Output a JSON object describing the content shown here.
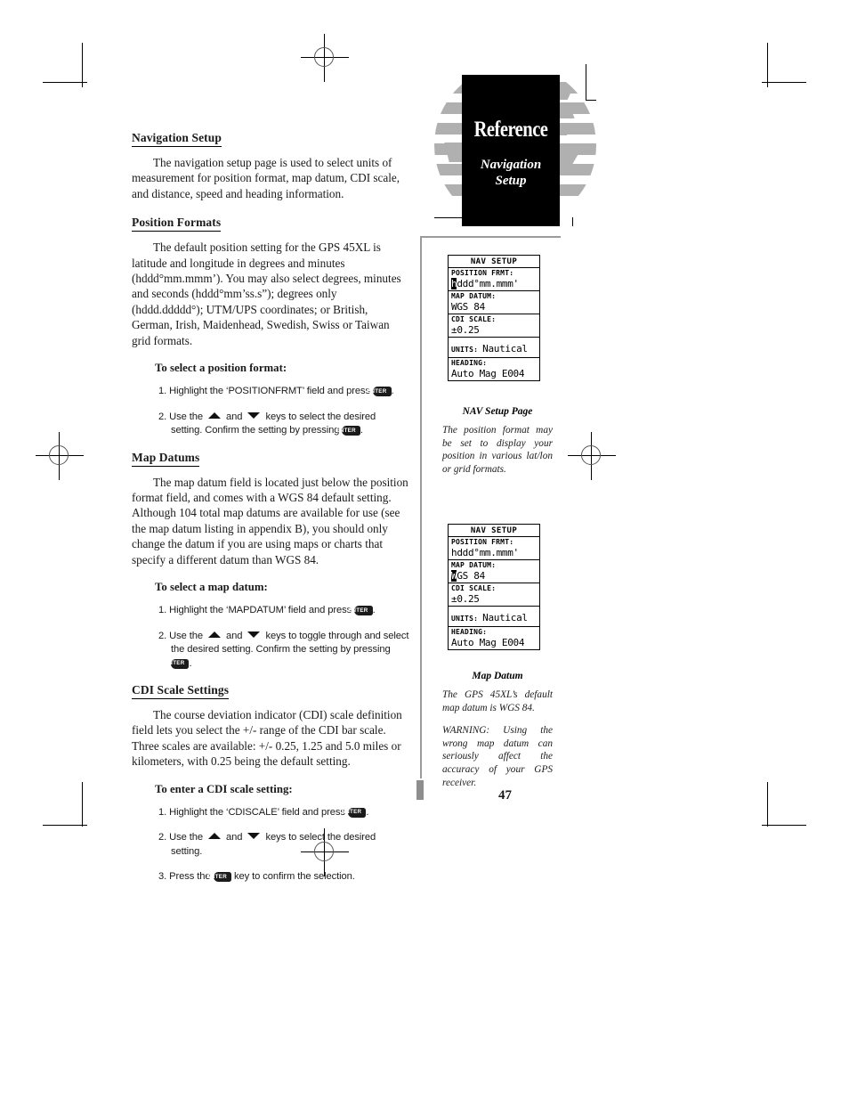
{
  "header": {
    "reference_label": "Reference",
    "section_line1": "Navigation",
    "section_line2": "Setup"
  },
  "page_number": "47",
  "left_column": {
    "sections": [
      {
        "heading": "Navigation Setup",
        "paragraphs": [
          "The navigation setup page is used to select units of measurement for position format, map datum, CDI scale, and distance, speed and heading information."
        ]
      },
      {
        "heading": "Position Formats",
        "paragraphs": [
          "The default position setting for the GPS 45XL is latitude and longitude in degrees and minutes (hddd°mm.mmm’). You may also select degrees, minutes and seconds (hddd°mm’ss.s”); degrees only (hddd.ddddd°); UTM/UPS coordinates; or British, German, Irish, Maidenhead, Swedish, Swiss or Taiwan grid formats."
        ],
        "procedure_title": "To select a position format:",
        "steps": [
          {
            "num": "1.",
            "before": "Highlight the ‘POSITIONFRMT’ field and press",
            "key1": "ENTER",
            "after": "."
          },
          {
            "num": "2.",
            "before": "Use the",
            "arrows": true,
            "mid": "and",
            "after_arrows": "keys to select the desired setting. Confirm the setting by pressing",
            "key1": "ENTER",
            "after": "."
          }
        ]
      },
      {
        "heading": "Map Datums",
        "paragraphs": [
          "The map datum field is located just below the position format field, and comes with a WGS 84 default setting. Although 104 total map datums are available for use (see the map datum listing in appendix B), you should only change the datum if you are using maps or charts that specify a different datum than WGS 84."
        ],
        "procedure_title": "To select a map datum:",
        "steps": [
          {
            "num": "1.",
            "before": "Highlight the ‘MAPDATUM’ field and press",
            "key1": "ENTER",
            "after": "."
          },
          {
            "num": "2.",
            "before": "Use the",
            "arrows": true,
            "mid": "and",
            "after_arrows": "keys to toggle through and select the desired setting. Confirm the setting by pressing",
            "key1": "ENTER",
            "after": "."
          }
        ]
      },
      {
        "heading": "CDI Scale Settings",
        "paragraphs": [
          "The course deviation indicator (CDI) scale definition field lets you select the +/- range of the CDI bar scale. Three scales are available: +/- 0.25, 1.25 and 5.0 miles or kilometers, with 0.25 being the default setting."
        ],
        "procedure_title": "To enter a CDI scale setting:",
        "steps": [
          {
            "num": "1.",
            "before": "Highlight the ‘CDISCALE’ field and press",
            "key1": "ENTER",
            "after": "."
          },
          {
            "num": "2.",
            "before": "Use the",
            "arrows": true,
            "mid": "and",
            "after_arrows": "keys to select the desired setting."
          },
          {
            "num": "3.",
            "before": "Press the",
            "key1": "ENTER",
            "after": "key to confirm the selection."
          }
        ]
      }
    ]
  },
  "right_column": {
    "figure1": {
      "screen": {
        "title": "NAV SETUP",
        "rows": [
          {
            "label": "POSITION FRMT:",
            "value": "hddd°mm.mmm'",
            "highlight_chars": 1
          },
          {
            "label": "MAP DATUM:",
            "value": "WGS 84",
            "highlight_chars": 0
          },
          {
            "label": "CDI SCALE:",
            "value": "±0.25",
            "highlight_chars": 0
          },
          {
            "label": "UNITS:",
            "value": "Nautical",
            "inline": true
          },
          {
            "label": "HEADING:",
            "value": "Auto Mag E004",
            "highlight_chars": 0
          }
        ]
      },
      "caption_title": "NAV Setup Page",
      "caption_body": "The position format may be set to display your position in various lat/lon or grid formats."
    },
    "figure2": {
      "screen": {
        "title": "NAV SETUP",
        "rows": [
          {
            "label": "POSITION FRMT:",
            "value": "hddd°mm.mmm'",
            "highlight_chars": 0
          },
          {
            "label": "MAP DATUM:",
            "value": "WGS 84",
            "highlight_chars": 1
          },
          {
            "label": "CDI SCALE:",
            "value": "±0.25",
            "highlight_chars": 0
          },
          {
            "label": "UNITS:",
            "value": "Nautical",
            "inline": true
          },
          {
            "label": "HEADING:",
            "value": "Auto Mag E004",
            "highlight_chars": 0
          }
        ]
      },
      "caption_title": "Map Datum",
      "caption_body": "The GPS 45XL’s default map datum is WGS 84.",
      "caption_warning": "WARNING: Using the wrong map datum can seriously affect the accuracy of your GPS receiver."
    }
  }
}
